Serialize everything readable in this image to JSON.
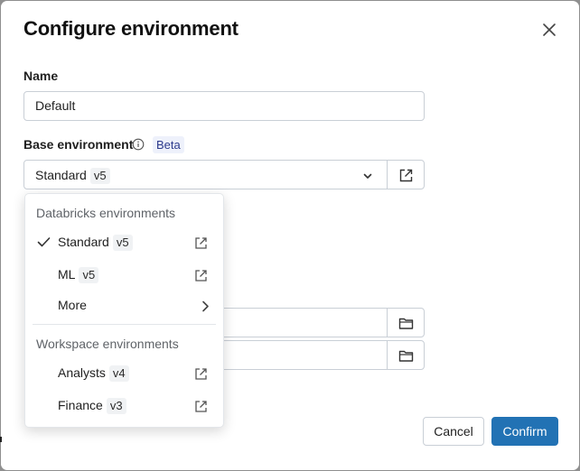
{
  "dialog": {
    "title": "Configure environment",
    "name_label": "Name",
    "name_value": "Default",
    "base_env_label": "Base environment",
    "beta_badge": "Beta",
    "selected_env": {
      "name": "Standard",
      "version": "v5"
    }
  },
  "menu": {
    "group1_label": "Databricks environments",
    "group1_items": [
      {
        "name": "Standard",
        "version": "v5",
        "checked": true
      },
      {
        "name": "ML",
        "version": "v5",
        "checked": false
      },
      {
        "name": "More",
        "has_submenu": true
      }
    ],
    "group2_label": "Workspace environments",
    "group2_items": [
      {
        "name": "Analysts",
        "version": "v4"
      },
      {
        "name": "Finance",
        "version": "v3"
      }
    ]
  },
  "buttons": {
    "cancel": "Cancel",
    "confirm": "Confirm"
  },
  "colors": {
    "primary": "#2272b4",
    "beta_text": "#2c3a8c",
    "beta_bg": "#eef1fb"
  }
}
